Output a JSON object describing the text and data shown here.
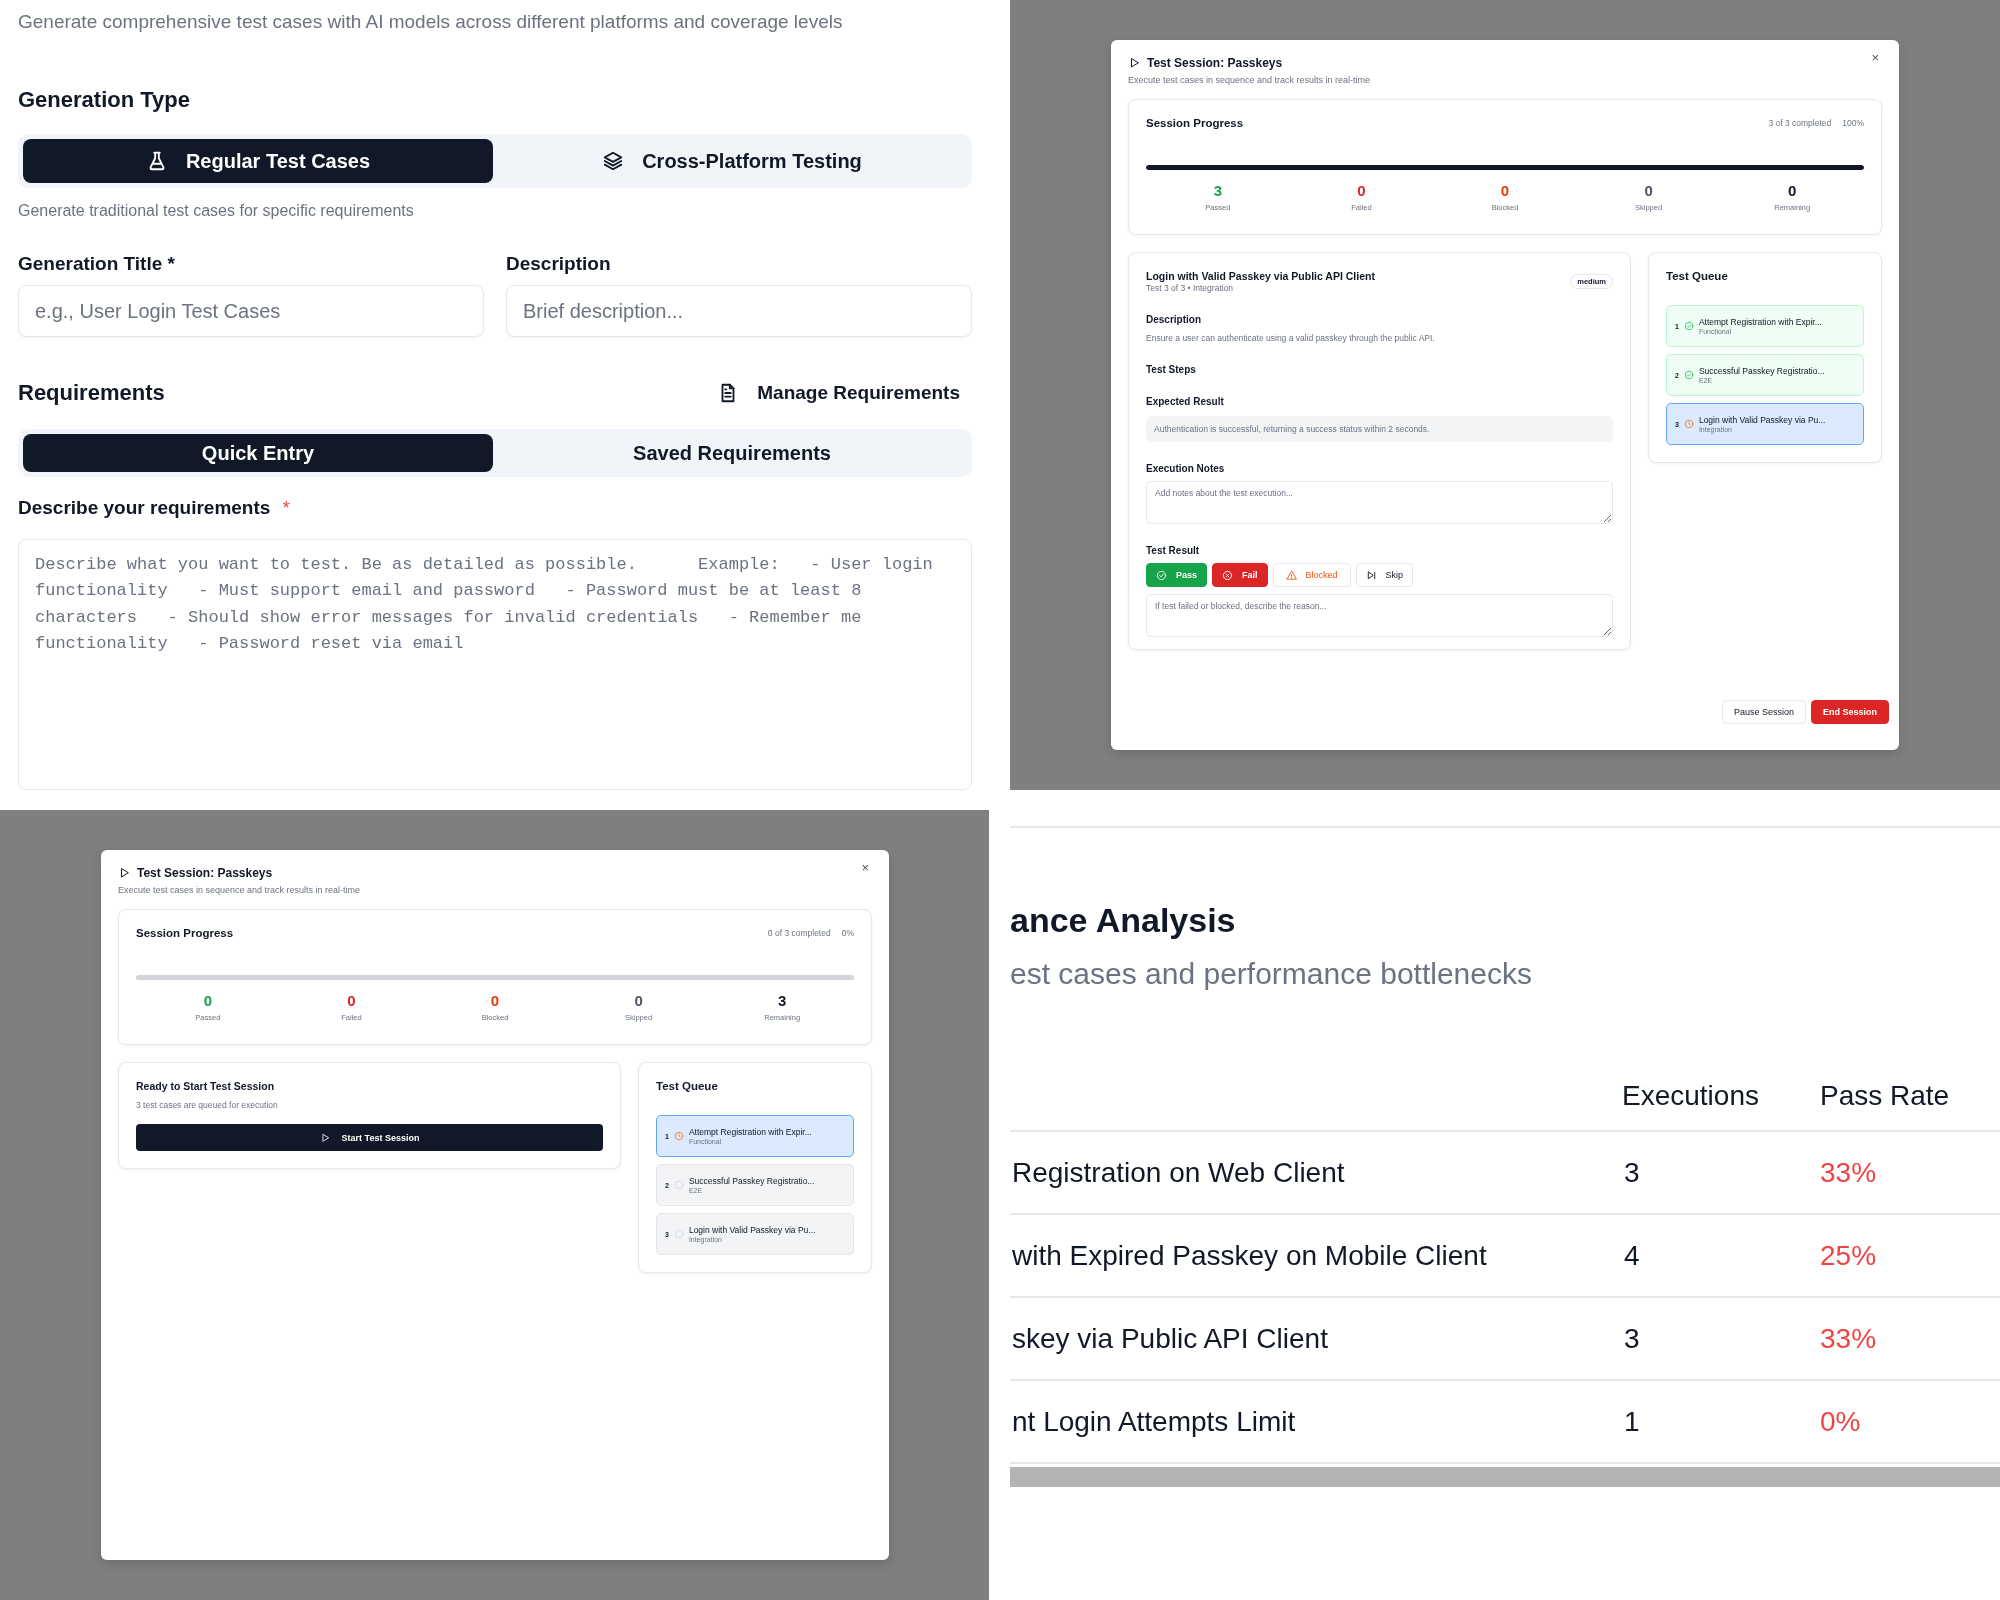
{
  "generator": {
    "subtitle": "Generate comprehensive test cases with AI models across different platforms and coverage levels",
    "generation_type": {
      "heading": "Generation Type",
      "options": [
        {
          "label": "Regular Test Cases",
          "kind": "flask",
          "selected": true
        },
        {
          "label": "Cross-Platform Testing",
          "kind": "layers",
          "selected": false
        }
      ],
      "hint": "Generate traditional test cases for specific requirements"
    },
    "fields": [
      {
        "label": "Generation Title *",
        "placeholder": "e.g., User Login Test Cases"
      },
      {
        "label": "Description",
        "placeholder": "Brief description..."
      }
    ],
    "requirements": {
      "heading": "Requirements",
      "manage_link": "Manage Requirements",
      "tabs": [
        {
          "label": "Quick Entry",
          "selected": true
        },
        {
          "label": "Saved Requirements",
          "selected": false
        }
      ],
      "prompt_label": "Describe your requirements",
      "required_mark": "*",
      "placeholder": "Describe what you want to test. Be as detailed as possible.      Example:   - User login functionality   - Must support email and password   - Password must be at least 8 characters   - Should show error messages for invalid credentials   - Remember me functionality   - Password reset via email"
    }
  },
  "sessions": [
    {
      "title": "Test Session: Passkeys",
      "subtitle": "Execute test cases in sequence and track results in real-time",
      "close": "×",
      "progress": {
        "heading": "Session Progress",
        "completed": "3 of 3 completed",
        "percent": "100%",
        "level": 1,
        "stats": [
          {
            "value": "3",
            "label": "Passed",
            "kind": "passed"
          },
          {
            "value": "0",
            "label": "Failed",
            "kind": "failed"
          },
          {
            "value": "0",
            "label": "Blocked",
            "kind": "blocked"
          },
          {
            "value": "0",
            "label": "Skipped",
            "kind": "skipped"
          },
          {
            "value": "0",
            "label": "Remaining",
            "kind": "remaining"
          }
        ]
      },
      "main": {
        "kind": "test",
        "title": "Login with Valid Passkey via Public API Client",
        "meta": "Test 3 of 3 • Integration",
        "priority": "medium",
        "description_heading": "Description",
        "description": "Ensure a user can authenticate using a valid passkey through the public API.",
        "steps_heading": "Test Steps",
        "expected_heading": "Expected Result",
        "expected": "Authentication is successful, returning a success status within 2 seconds.",
        "notes_heading": "Execution Notes",
        "notes_placeholder": "Add notes about the test execution...",
        "result_heading": "Test Result",
        "result_buttons": [
          {
            "label": "Pass",
            "kind": "pass"
          },
          {
            "label": "Fail",
            "kind": "fail"
          },
          {
            "label": "Blocked",
            "kind": "blocked"
          },
          {
            "label": "Skip",
            "kind": "skip"
          }
        ],
        "reason_placeholder": "If test failed or blocked, describe the reason..."
      },
      "queue": {
        "heading": "Test Queue",
        "items": [
          {
            "number": "1",
            "title": "Attempt Registration with Expir...",
            "category": "Functional",
            "kind": "passed",
            "selected": false
          },
          {
            "number": "2",
            "title": "Successful Passkey Registratio...",
            "category": "E2E",
            "kind": "passed",
            "selected": false
          },
          {
            "number": "3",
            "title": "Login with Valid Passkey via Pu...",
            "category": "Integration",
            "kind": "current",
            "selected": true
          }
        ]
      },
      "footer": [
        {
          "label": "Pause Session",
          "kind": "secondary"
        },
        {
          "label": "End Session",
          "kind": "danger"
        }
      ]
    },
    {
      "title": "Test Session: Passkeys",
      "subtitle": "Execute test cases in sequence and track results in real-time",
      "close": "×",
      "progress": {
        "heading": "Session Progress",
        "completed": "0 of 3 completed",
        "percent": "0%",
        "level": 0,
        "stats": [
          {
            "value": "0",
            "label": "Passed",
            "kind": "passed"
          },
          {
            "value": "0",
            "label": "Failed",
            "kind": "failed"
          },
          {
            "value": "0",
            "label": "Blocked",
            "kind": "blocked"
          },
          {
            "value": "0",
            "label": "Skipped",
            "kind": "skipped"
          },
          {
            "value": "3",
            "label": "Remaining",
            "kind": "remaining"
          }
        ]
      },
      "main": {
        "kind": "ready",
        "title": "Ready to Start Test Session",
        "text": "3 test cases are queued for execution",
        "button": "Start Test Session"
      },
      "queue": {
        "heading": "Test Queue",
        "items": [
          {
            "number": "1",
            "title": "Attempt Registration with Expir...",
            "category": "Functional",
            "kind": "current",
            "selected": true
          },
          {
            "number": "2",
            "title": "Successful Passkey Registratio...",
            "category": "E2E",
            "kind": "pending",
            "selected": false
          },
          {
            "number": "3",
            "title": "Login with Valid Passkey via Pu...",
            "category": "Integration",
            "kind": "pending",
            "selected": false
          }
        ]
      }
    }
  ],
  "analysis": {
    "heading": "ance Analysis",
    "subtitle": "est cases and performance bottlenecks",
    "table": {
      "columns": [
        "",
        "Executions",
        "Pass Rate"
      ],
      "rows": [
        [
          "Registration on Web Client",
          "3",
          "33%"
        ],
        [
          "with Expired Passkey on Mobile Client",
          "4",
          "25%"
        ],
        [
          "skey via Public API Client",
          "3",
          "33%"
        ],
        [
          "nt Login Attempts Limit",
          "1",
          "0%"
        ]
      ]
    }
  }
}
